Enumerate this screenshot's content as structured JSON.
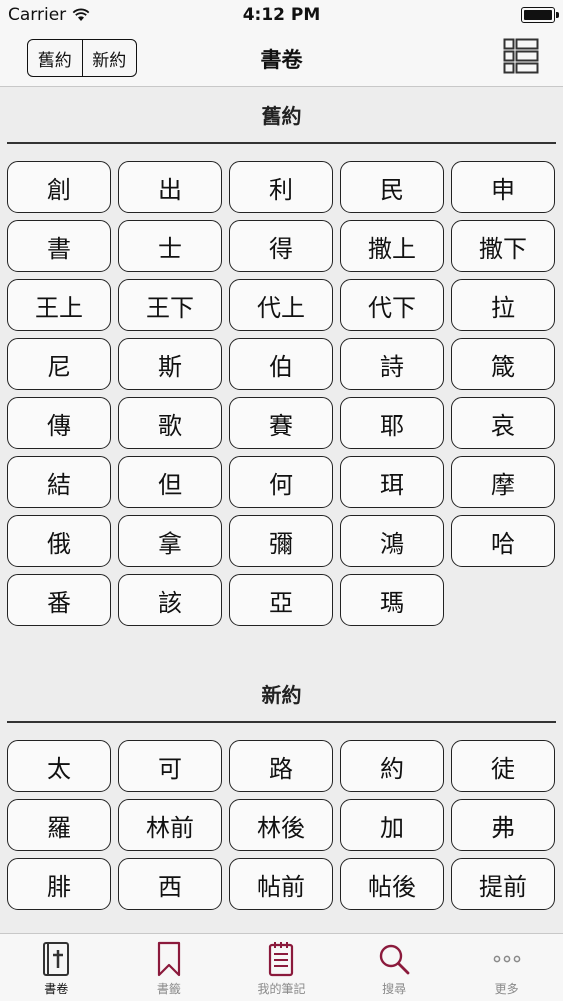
{
  "status_bar": {
    "carrier": "Carrier",
    "time": "4:12 PM"
  },
  "nav": {
    "title": "書卷",
    "segments": [
      "舊約",
      "新約"
    ]
  },
  "sections": [
    {
      "title": "舊約",
      "books": [
        "創",
        "出",
        "利",
        "民",
        "申",
        "書",
        "士",
        "得",
        "撒上",
        "撒下",
        "王上",
        "王下",
        "代上",
        "代下",
        "拉",
        "尼",
        "斯",
        "伯",
        "詩",
        "箴",
        "傳",
        "歌",
        "賽",
        "耶",
        "哀",
        "結",
        "但",
        "何",
        "珥",
        "摩",
        "俄",
        "拿",
        "彌",
        "鴻",
        "哈",
        "番",
        "該",
        "亞",
        "瑪"
      ]
    },
    {
      "title": "新約",
      "books": [
        "太",
        "可",
        "路",
        "約",
        "徒",
        "羅",
        "林前",
        "林後",
        "加",
        "弗",
        "腓",
        "西",
        "帖前",
        "帖後",
        "提前"
      ]
    }
  ],
  "tab_bar": {
    "tabs": [
      {
        "label": "書卷",
        "icon": "bible-book-icon"
      },
      {
        "label": "書籤",
        "icon": "bookmark-icon"
      },
      {
        "label": "我的筆記",
        "icon": "notepad-icon"
      },
      {
        "label": "搜尋",
        "icon": "search-icon"
      },
      {
        "label": "更多",
        "icon": "more-dots-icon"
      }
    ]
  },
  "colors": {
    "accent": "#8b1a3c",
    "inactive_tab_text": "#8a8a8a"
  }
}
